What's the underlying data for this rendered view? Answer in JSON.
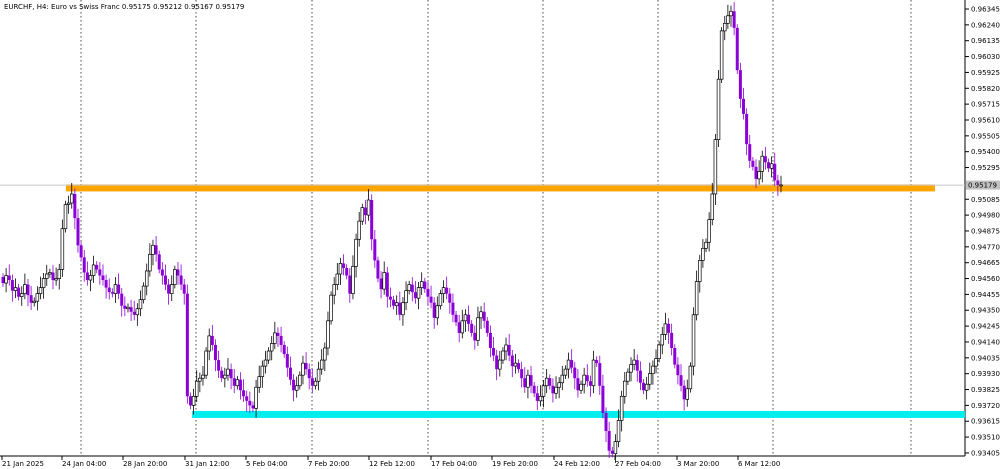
{
  "chart_info": "EURCHF, H4:  Euro vs Swiss Franc  0.95175 0.95212 0.95167 0.95179",
  "colors": {
    "background": "#ffffff",
    "grid": "#000000",
    "bull_candle": "#000000",
    "bear_candle": "#8b00d6",
    "resistance": "#ffa500",
    "support": "#00eeee",
    "price_tag": "#c0c0c0"
  },
  "chart_data": {
    "type": "candlestick",
    "title": "EURCHF, H4:  Euro vs Swiss Franc",
    "ohlc_header": [
      0.95175,
      0.95212,
      0.95167,
      0.95179
    ],
    "current_price_label": "0.95179",
    "x_tick_labels": [
      "21 Jan 2025",
      "24 Jan 04:00",
      "28 Jan 20:00",
      "31 Jan 12:00",
      "5 Feb 04:00",
      "7 Feb 20:00",
      "12 Feb 12:00",
      "17 Feb 04:00",
      "19 Feb 20:00",
      "24 Feb 12:00",
      "27 Feb 04:00",
      "3 Mar 20:00",
      "6 Mar 12:00"
    ],
    "y_tick_labels": [
      "0.96345",
      "0.96240",
      "0.96135",
      "0.96030",
      "0.95925",
      "0.95820",
      "0.95715",
      "0.95610",
      "0.95505",
      "0.95400",
      "0.95295",
      "0.95085",
      "0.94980",
      "0.94875",
      "0.94770",
      "0.94665",
      "0.94560",
      "0.94455",
      "0.94350",
      "0.94245",
      "0.94140",
      "0.94035",
      "0.93930",
      "0.93825",
      "0.93720",
      "0.93615",
      "0.93510",
      "0.93405"
    ],
    "ylim": [
      0.9333,
      0.9639
    ],
    "horizontal_levels": [
      {
        "name": "resistance",
        "price": 0.9516,
        "color": "#ffa500"
      },
      {
        "name": "support",
        "price": 0.9366,
        "color": "#00eeee"
      }
    ],
    "candle_closes": [
      0.9453,
      0.9458,
      0.9455,
      0.9448,
      0.945,
      0.9444,
      0.9446,
      0.9452,
      0.9445,
      0.944,
      0.9441,
      0.9446,
      0.945,
      0.9456,
      0.9459,
      0.946,
      0.9455,
      0.9456,
      0.9462,
      0.9489,
      0.9505,
      0.9506,
      0.9512,
      0.9496,
      0.9478,
      0.947,
      0.946,
      0.9455,
      0.9458,
      0.9465,
      0.9462,
      0.9458,
      0.9455,
      0.945,
      0.9447,
      0.9446,
      0.9452,
      0.9446,
      0.9438,
      0.9436,
      0.9437,
      0.9434,
      0.9432,
      0.9436,
      0.9442,
      0.9451,
      0.9461,
      0.9472,
      0.9478,
      0.9472,
      0.9462,
      0.9458,
      0.9452,
      0.9446,
      0.9452,
      0.9462,
      0.9458,
      0.9452,
      0.9446,
      0.9378,
      0.9372,
      0.9378,
      0.9388,
      0.939,
      0.9392,
      0.9408,
      0.9418,
      0.9412,
      0.9402,
      0.9395,
      0.939,
      0.9392,
      0.9396,
      0.939,
      0.9385,
      0.9389,
      0.9382,
      0.9378,
      0.9375,
      0.9372,
      0.937,
      0.9384,
      0.9391,
      0.9398,
      0.9402,
      0.9408,
      0.9413,
      0.942,
      0.9418,
      0.9412,
      0.9406,
      0.9397,
      0.9389,
      0.9382,
      0.9385,
      0.9392,
      0.94,
      0.9396,
      0.939,
      0.9385,
      0.9388,
      0.9396,
      0.9402,
      0.941,
      0.9428,
      0.9445,
      0.9452,
      0.9459,
      0.9466,
      0.9463,
      0.9458,
      0.9446,
      0.9464,
      0.9482,
      0.9494,
      0.9503,
      0.9498,
      0.9508,
      0.9482,
      0.9468,
      0.9456,
      0.9449,
      0.946,
      0.9444,
      0.9442,
      0.9438,
      0.944,
      0.9432,
      0.944,
      0.9448,
      0.9452,
      0.9447,
      0.9443,
      0.945,
      0.9454,
      0.9449,
      0.9444,
      0.944,
      0.943,
      0.9438,
      0.9446,
      0.945,
      0.9446,
      0.944,
      0.9432,
      0.9427,
      0.942,
      0.9428,
      0.9432,
      0.9426,
      0.942,
      0.9415,
      0.943,
      0.9434,
      0.9428,
      0.942,
      0.941,
      0.9405,
      0.9396,
      0.9402,
      0.9408,
      0.9412,
      0.9405,
      0.9398,
      0.94,
      0.9396,
      0.939,
      0.9384,
      0.9392,
      0.9385,
      0.938,
      0.9375,
      0.9378,
      0.9385,
      0.939,
      0.9385,
      0.938,
      0.9384,
      0.9387,
      0.9392,
      0.9396,
      0.9402,
      0.9397,
      0.939,
      0.9382,
      0.9386,
      0.9392,
      0.9388,
      0.9385,
      0.9402,
      0.94,
      0.9385,
      0.9367,
      0.9355,
      0.9342,
      0.934,
      0.9348,
      0.9362,
      0.9378,
      0.9388,
      0.9394,
      0.9399,
      0.9402,
      0.9395,
      0.9387,
      0.9382,
      0.9386,
      0.9393,
      0.9398,
      0.9403,
      0.9412,
      0.9419,
      0.9426,
      0.942,
      0.941,
      0.9399,
      0.9392,
      0.9385,
      0.9376,
      0.9383,
      0.9398,
      0.9432,
      0.9454,
      0.9468,
      0.9476,
      0.948,
      0.9495,
      0.9512,
      0.9548,
      0.9588,
      0.962,
      0.9625,
      0.963,
      0.9633,
      0.9622,
      0.9594,
      0.9575,
      0.9565,
      0.9545,
      0.9534,
      0.953,
      0.9522,
      0.9527,
      0.9537,
      0.9533,
      0.9529,
      0.9532,
      0.9521,
      0.9518,
      0.9518
    ]
  }
}
